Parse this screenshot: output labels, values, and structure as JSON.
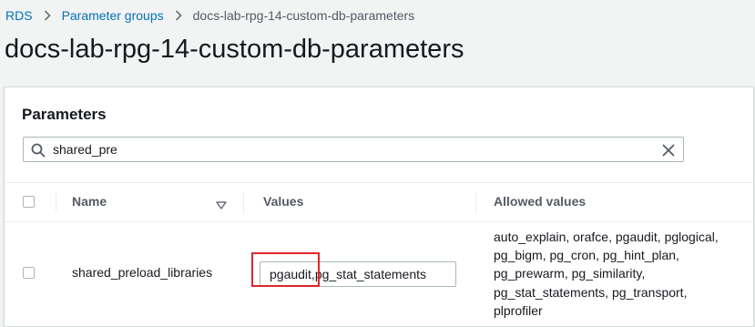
{
  "breadcrumb": {
    "items": [
      "RDS",
      "Parameter groups",
      "docs-lab-rpg-14-custom-db-parameters"
    ]
  },
  "page": {
    "title": "docs-lab-rpg-14-custom-db-parameters"
  },
  "parameters": {
    "title": "Parameters",
    "search": {
      "value": "shared_pre",
      "icon": "search-icon",
      "clear_icon": "close-icon"
    },
    "columns": {
      "name": "Name",
      "values": "Values",
      "allowed_values": "Allowed values"
    },
    "rows": [
      {
        "selected": false,
        "name": "shared_preload_libraries",
        "value": "pgaudit,pg_stat_statements",
        "allowed_values_lines": [
          "auto_explain, orafce, pgaudit, pglogical,",
          "pg_bigm, pg_cron, pg_hint_plan,",
          "pg_prewarm, pg_similarity,",
          "pg_stat_statements, pg_transport,",
          "plprofiler"
        ]
      }
    ]
  },
  "colors": {
    "link": "#0073bb",
    "highlight": "#e0262a",
    "background": "#f2f3f3"
  }
}
